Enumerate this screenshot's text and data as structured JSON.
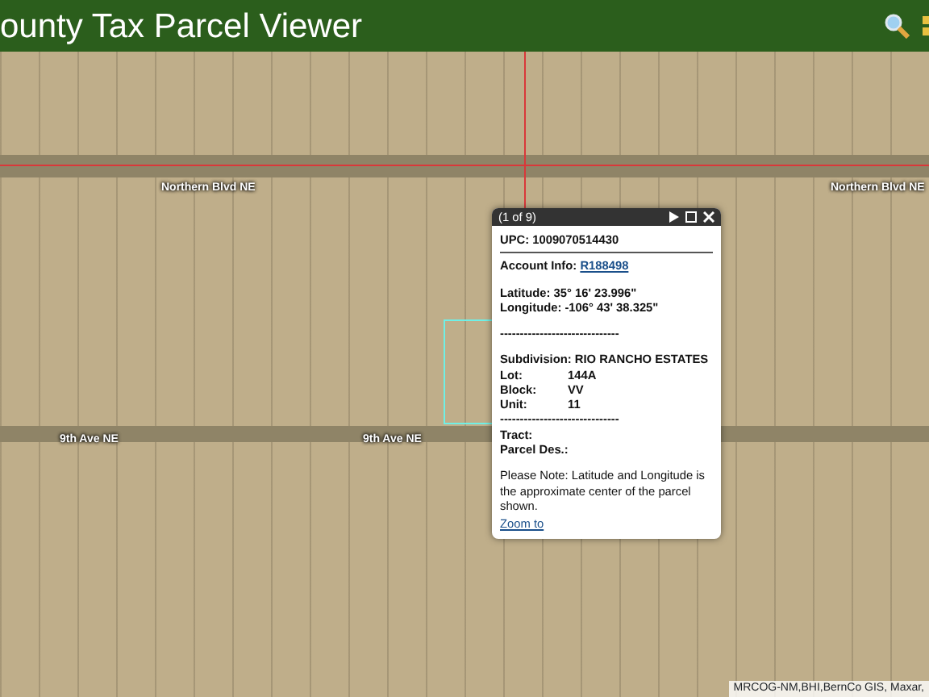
{
  "header": {
    "title": "ounty Tax Parcel Viewer"
  },
  "map": {
    "roads": [
      {
        "labels": [
          "Northern Blvd NE",
          "Northern Blvd NE"
        ]
      },
      {
        "labels": [
          "9th Ave NE",
          "9th Ave NE"
        ]
      }
    ]
  },
  "popup": {
    "counter": "(1 of 9)",
    "lines": [
      {
        "kind": "field",
        "label": "UPC:",
        "value": "1009070514430"
      },
      {
        "kind": "rule"
      },
      {
        "kind": "link-field",
        "label": "Account Info:",
        "value": "R188498"
      },
      {
        "kind": "gap"
      },
      {
        "kind": "field",
        "label": "Latitude:",
        "value": "35° 16' 23.996\""
      },
      {
        "kind": "field",
        "label": "Longitude:",
        "value": "-106° 43' 38.325\""
      },
      {
        "kind": "gap"
      },
      {
        "kind": "text",
        "value": "------------------------------"
      },
      {
        "kind": "gap"
      },
      {
        "kind": "field",
        "label": "Subdivision:",
        "value": "RIO RANCHO ESTATES"
      },
      {
        "kind": "column",
        "label": "Lot:",
        "value": "144A"
      },
      {
        "kind": "column",
        "label": "Block:",
        "value": "VV"
      },
      {
        "kind": "column",
        "label": "Unit:",
        "value": "11"
      },
      {
        "kind": "text",
        "value": "------------------------------"
      },
      {
        "kind": "column",
        "label": "Tract:"
      },
      {
        "kind": "column",
        "label": "Parcel Des.:"
      },
      {
        "kind": "gap"
      },
      {
        "kind": "note",
        "value": "Please Note: Latitude and Longitude is the approximate center of the parcel shown."
      },
      {
        "kind": "link",
        "value": "Zoom to"
      }
    ]
  },
  "attribution": "MRCOG-NM,BHI,BernCo GIS, Maxar,"
}
